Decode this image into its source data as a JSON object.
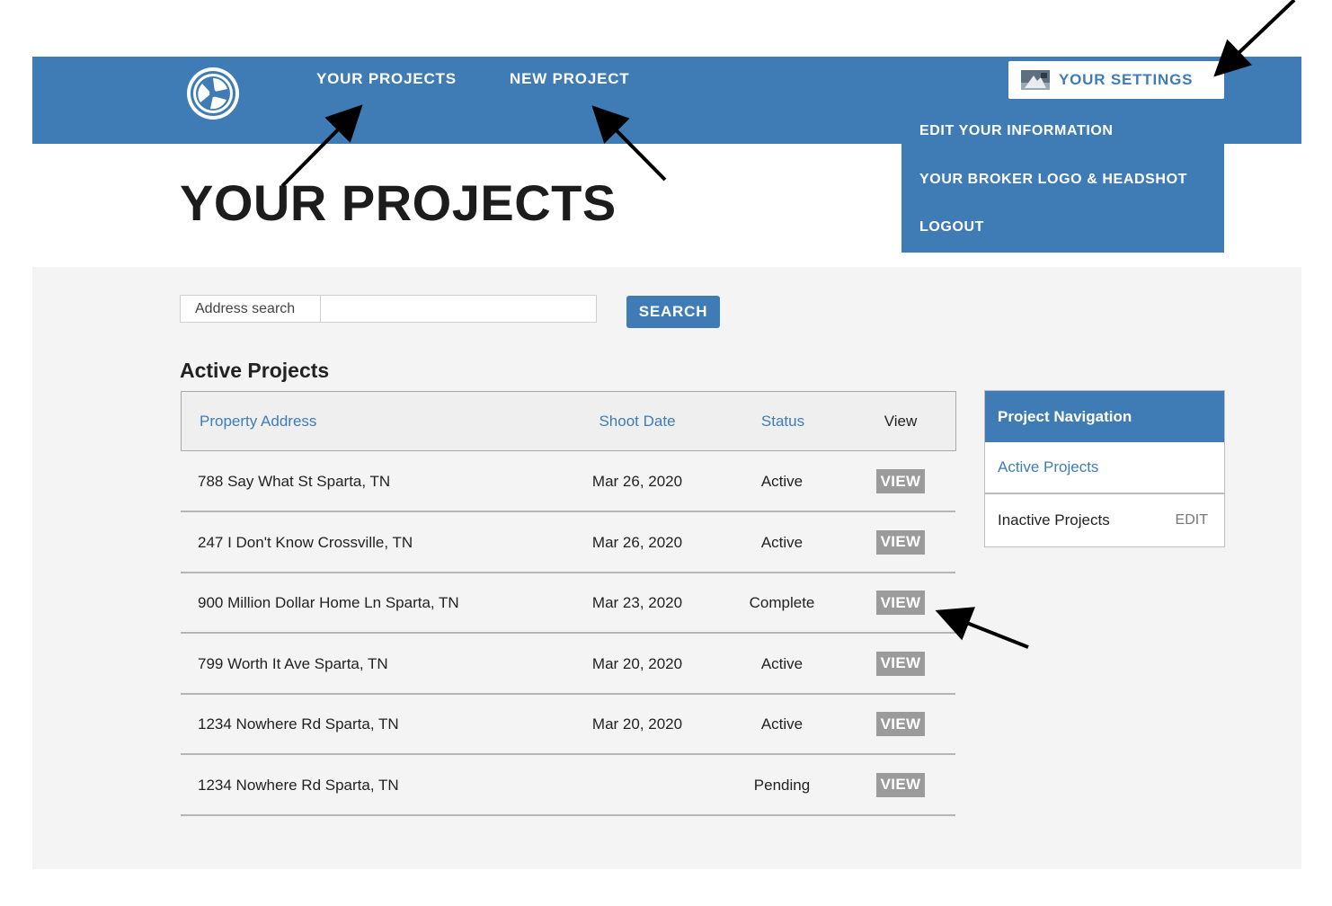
{
  "header": {
    "nav": [
      {
        "label": "YOUR PROJECTS"
      },
      {
        "label": "NEW PROJECT"
      }
    ],
    "settings_label": "YOUR SETTINGS",
    "dropdown": [
      {
        "label": "EDIT YOUR INFORMATION"
      },
      {
        "label": "YOUR BROKER LOGO & HEADSHOT"
      },
      {
        "label": "LOGOUT"
      }
    ]
  },
  "page_title": "YOUR PROJECTS",
  "search": {
    "label": "Address search",
    "value": "",
    "button_label": "SEARCH"
  },
  "active_projects": {
    "title": "Active Projects",
    "columns": [
      "Property Address",
      "Shoot Date",
      "Status",
      "View"
    ],
    "rows": [
      {
        "address": "788 Say What St Sparta, TN",
        "date": "Mar 26, 2020",
        "status": "Active",
        "view": "VIEW"
      },
      {
        "address": "247 I Don't Know Crossville, TN",
        "date": "Mar 26, 2020",
        "status": "Active",
        "view": "VIEW"
      },
      {
        "address": "900 Million Dollar Home Ln Sparta, TN",
        "date": "Mar 23, 2020",
        "status": "Complete",
        "view": "VIEW"
      },
      {
        "address": "799 Worth It Ave Sparta, TN",
        "date": "Mar 20, 2020",
        "status": "Active",
        "view": "VIEW"
      },
      {
        "address": "1234 Nowhere Rd Sparta, TN",
        "date": "Mar 20, 2020",
        "status": "Active",
        "view": "VIEW"
      },
      {
        "address": "1234 Nowhere Rd Sparta, TN",
        "date": "",
        "status": "Pending",
        "view": "VIEW"
      }
    ]
  },
  "side_nav": {
    "title": "Project Navigation",
    "items": [
      {
        "label": "Active Projects",
        "active": true
      },
      {
        "label": "Inactive Projects",
        "edit": "EDIT"
      }
    ]
  },
  "colors": {
    "brand": "#3f7cb6",
    "view_button": "#9b9b9b",
    "content_bg": "#f4f4f4"
  },
  "icons": {
    "logo": "circular-aperture-logo",
    "settings_avatar": "broker-photo-thumbnail"
  }
}
